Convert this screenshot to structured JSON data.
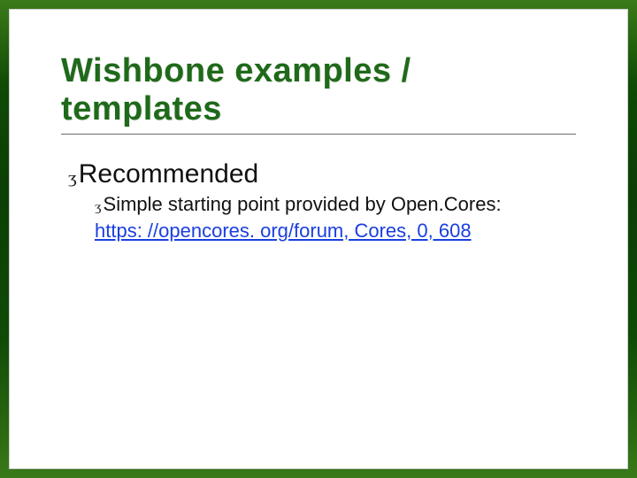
{
  "slide": {
    "title": "Wishbone examples / templates",
    "bullet_glyph": "ʒ",
    "items": {
      "level1": "Recommended",
      "level2_lead": "Simple",
      "level2_rest": " starting point provided by Open.Cores:",
      "link_text": "https: //opencores. org/forum, Cores, 0, 608"
    },
    "colors": {
      "heading": "#1f6a1a",
      "link": "#1a3fe0",
      "frame_green_dark": "#0b3f04",
      "frame_green_light": "#3b7a1a"
    }
  }
}
